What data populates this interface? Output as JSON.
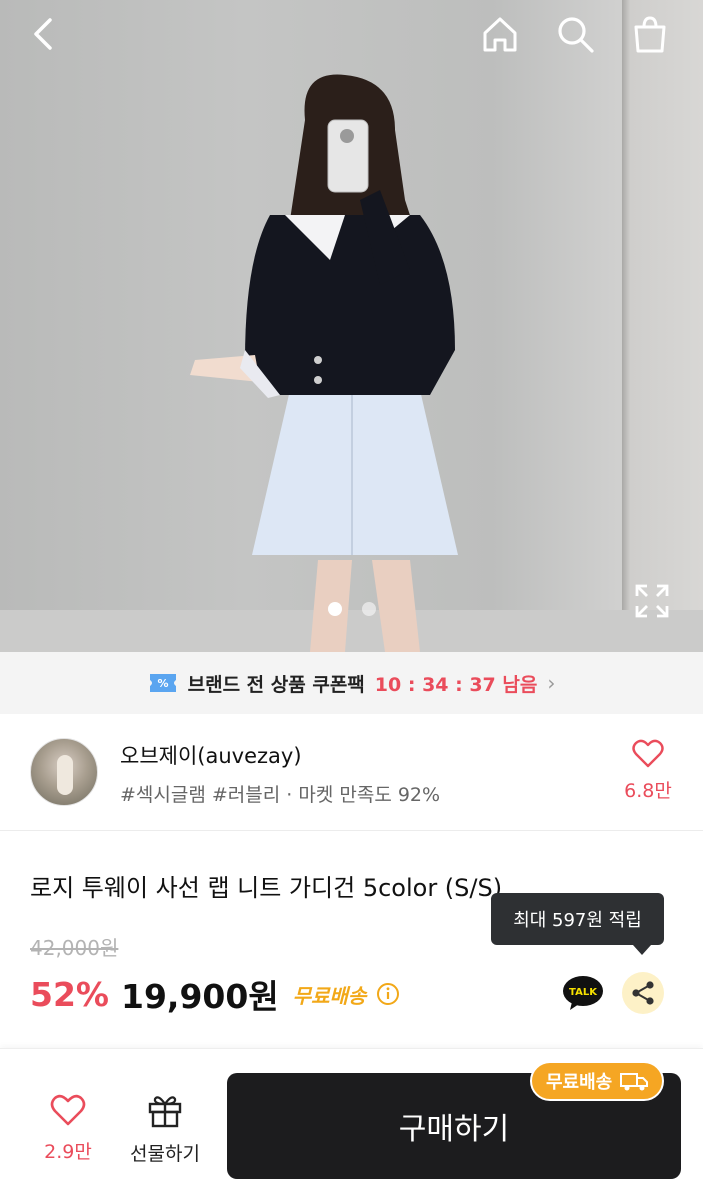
{
  "hero": {
    "slides_total": 2,
    "active_slide": 1
  },
  "coupon": {
    "text": "브랜드 전 상품 쿠폰팩",
    "timer": "10 : 34 : 37 남음",
    "chevron": "›"
  },
  "seller": {
    "name": "오브제이(auvezay)",
    "tags": "#섹시글램 #러블리 · 마켓 만족도 92%",
    "like_count": "6.8만"
  },
  "product": {
    "title": "로지 투웨이 사선 랩 니트 가디건 5color (S/S)",
    "original_price": "42,000원",
    "discount": "52%",
    "price": "19,900원",
    "shipping": "무료배송",
    "points_tooltip": "최대 597원 적립",
    "talk_label": "TALK"
  },
  "bottom_bar": {
    "like_count": "2.9만",
    "gift_label": "선물하기",
    "buy_label": "구매하기",
    "buy_badge": "무료배송"
  },
  "colors": {
    "accent": "#ea4c5b",
    "shipping": "#f2a818",
    "buy_button": "#1c1c1e"
  }
}
